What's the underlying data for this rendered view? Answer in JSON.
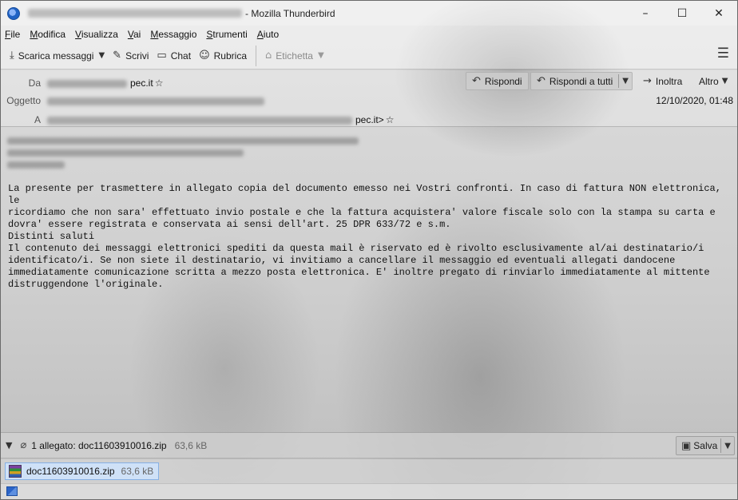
{
  "window": {
    "title_suffix": "- Mozilla Thunderbird",
    "minimize": "–",
    "maximize": "☐",
    "close": "✕"
  },
  "menu": [
    "File",
    "Modifica",
    "Visualizza",
    "Vai",
    "Messaggio",
    "Strumenti",
    "Aiuto"
  ],
  "toolbar": {
    "get_messages": "Scarica messaggi",
    "write": "Scrivi",
    "chat": "Chat",
    "address_book": "Rubrica",
    "tag": "Etichetta",
    "icons": {
      "get_messages": "download-icon",
      "write": "pencil-icon",
      "chat": "chat-icon",
      "address_book": "contacts-icon",
      "tag": "tag-icon",
      "menu": "hamburger-icon"
    }
  },
  "header": {
    "from_label": "Da",
    "from_suffix": "pec.it",
    "subject_label": "Oggetto",
    "to_label": "A",
    "to_suffix": "pec.it>",
    "date": "12/10/2020, 01:48",
    "reply": "Rispondi",
    "reply_all": "Rispondi a tutti",
    "forward": "Inoltra",
    "more": "Altro"
  },
  "body": {
    "paragraph1": "La presente per trasmettere in allegato copia del documento emesso nei Vostri confronti. In caso di fattura NON elettronica, le\nricordiamo che non sara' effettuato invio postale e che la fattura acquistera' valore fiscale solo con la stampa su carta e\ndovra' essere registrata e conservata ai sensi dell'art. 25 DPR 633/72 e s.m.\nDistinti saluti",
    "paragraph2": "Il contenuto dei messaggi elettronici spediti da questa mail è riservato ed è rivolto esclusivamente al/ai destinatario/i\nidentificato/i. Se non siete il destinatario, vi invitiamo a cancellare il messaggio ed eventuali allegati dandocene\nimmediatamente comunicazione scritta a mezzo posta elettronica. E' inoltre pregato di rinviarlo immediatamente al mittente\ndistruggendone l'originale."
  },
  "attachments": {
    "summary": "1 allegato: doc11603910016.zip",
    "total_size": "63,6 kB",
    "save": "Salva",
    "items": [
      {
        "name": "doc11603910016.zip",
        "size": "63,6 kB",
        "icon": "zip-archive-icon"
      }
    ]
  }
}
